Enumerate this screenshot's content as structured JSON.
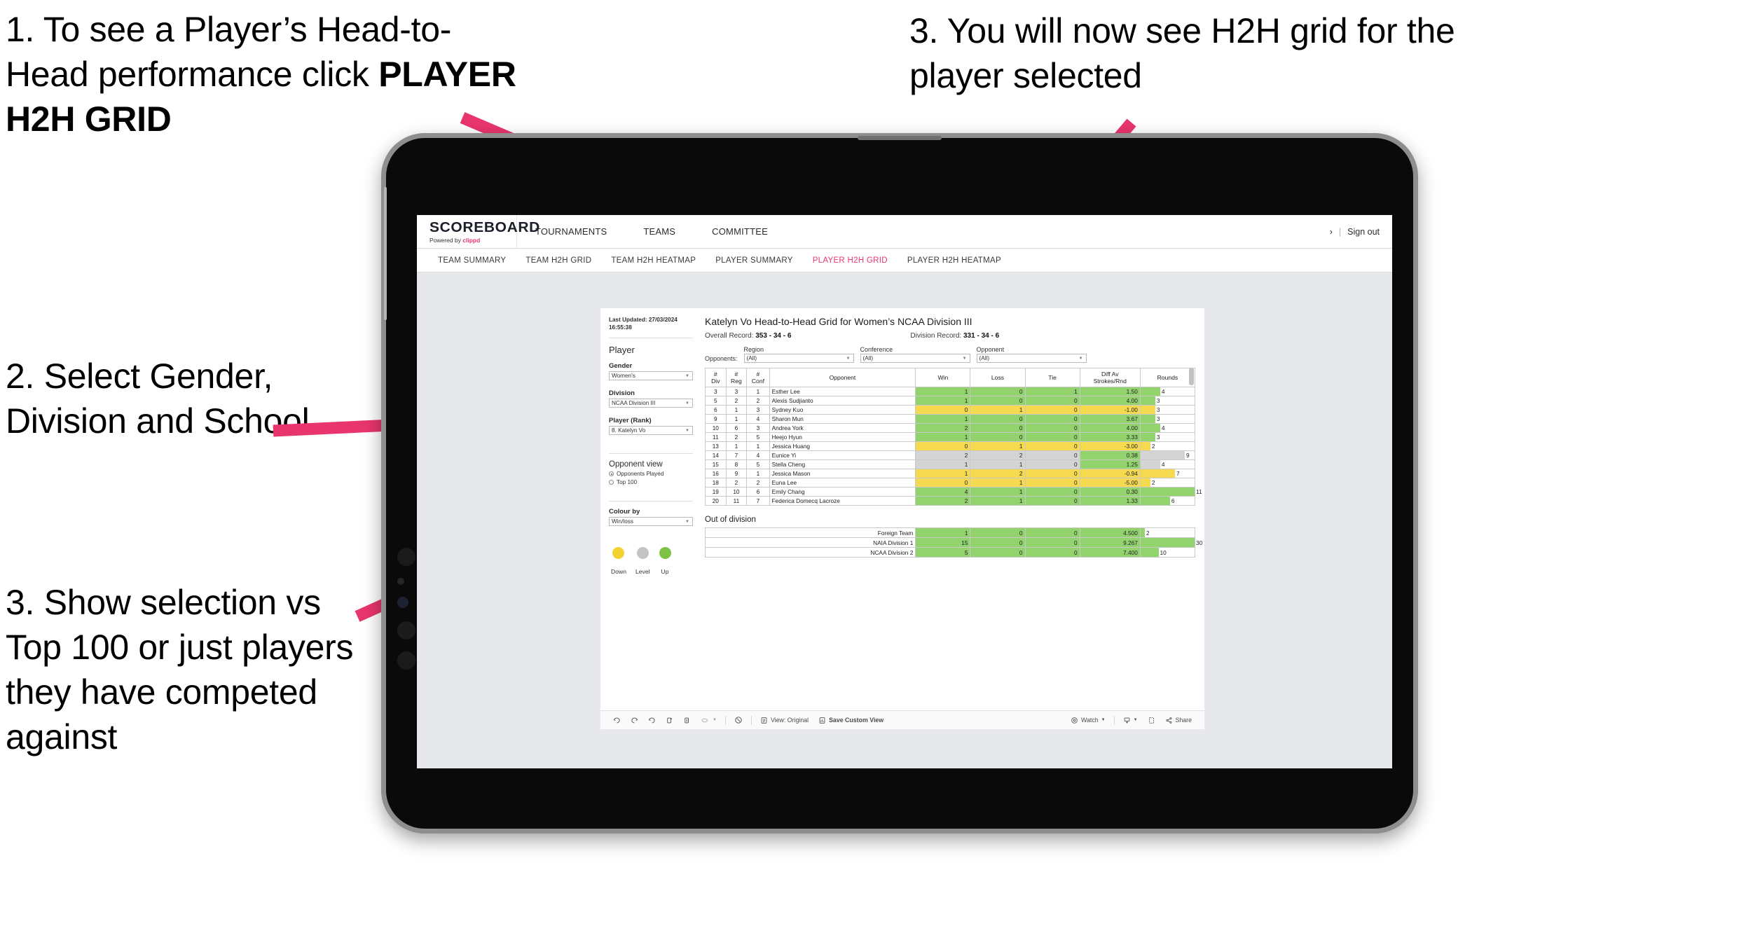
{
  "annotations": [
    {
      "id": 1,
      "pre": "1. To see a Player’s Head-to-Head performance click ",
      "strong": "PLAYER H2H GRID"
    },
    {
      "id": 2,
      "text": "2. Select Gender, Division and School"
    },
    {
      "id": 3,
      "text": "3. Show selection vs Top 100 or just players they have competed against"
    },
    {
      "id": 4,
      "text": "3. You will now see H2H grid for the player selected"
    }
  ],
  "app": {
    "brand_name": "SCOREBOARD",
    "brand_sub_prefix": "Powered by ",
    "brand_sub_accent": "clippd",
    "top_nav": [
      "TOURNAMENTS",
      "TEAMS",
      "COMMITTEE"
    ],
    "top_right": {
      "chevron": "›",
      "separator": "|",
      "sign_out": "Sign out"
    },
    "sub_nav": [
      {
        "label": "TEAM SUMMARY",
        "active": false
      },
      {
        "label": "TEAM H2H GRID",
        "active": false
      },
      {
        "label": "TEAM H2H HEATMAP",
        "active": false
      },
      {
        "label": "PLAYER SUMMARY",
        "active": false
      },
      {
        "label": "PLAYER H2H GRID",
        "active": true
      },
      {
        "label": "PLAYER H2H HEATMAP",
        "active": false
      }
    ],
    "accent_color": "#e8356d"
  },
  "sidebar": {
    "last_updated": "Last Updated: 27/03/2024 16:55:38",
    "player_heading": "Player",
    "filters": [
      {
        "label": "Gender",
        "value": "Women’s"
      },
      {
        "label": "Division",
        "value": "NCAA Division III"
      },
      {
        "label": "Player (Rank)",
        "value": "8. Katelyn Vo"
      }
    ],
    "opponent_view": {
      "heading": "Opponent view",
      "options": [
        {
          "label": "Opponents Played",
          "selected": true
        },
        {
          "label": "Top 100",
          "selected": false
        }
      ]
    },
    "colour_by": {
      "label": "Colour by",
      "value": "Win/loss"
    },
    "legend": [
      {
        "label": "Down",
        "color": "#f2d230"
      },
      {
        "label": "Level",
        "color": "#c3c3c3"
      },
      {
        "label": "Up",
        "color": "#7dc242"
      }
    ]
  },
  "main": {
    "title": "Katelyn Vo Head-to-Head Grid for Women’s NCAA Division III",
    "overall_record_label": "Overall Record: ",
    "overall_record": "353 - 34 - 6",
    "division_record_label": "Division Record: ",
    "division_record": "331 - 34 - 6",
    "opponents_label": "Opponents:",
    "opponent_filters": [
      {
        "label": "Region",
        "value": "(All)"
      },
      {
        "label": "Conference",
        "value": "(All)"
      },
      {
        "label": "Opponent",
        "value": "(All)"
      }
    ],
    "columns": [
      "# Div",
      "# Reg",
      "# Conf",
      "Opponent",
      "Win",
      "Loss",
      "Tie",
      "Diff Av Strokes/Rnd",
      "Rounds"
    ],
    "rows": [
      {
        "div": "3",
        "reg": "3",
        "conf": "1",
        "opponent": "Esther Lee",
        "win": "1",
        "loss": "0",
        "tie": "1",
        "diff": "1.50",
        "rounds": "4",
        "state": "up"
      },
      {
        "div": "5",
        "reg": "2",
        "conf": "2",
        "opponent": "Alexis Sudjianto",
        "win": "1",
        "loss": "0",
        "tie": "0",
        "diff": "4.00",
        "rounds": "3",
        "state": "up"
      },
      {
        "div": "6",
        "reg": "1",
        "conf": "3",
        "opponent": "Sydney Kuo",
        "win": "0",
        "loss": "1",
        "tie": "0",
        "diff": "-1.00",
        "rounds": "3",
        "state": "down"
      },
      {
        "div": "9",
        "reg": "1",
        "conf": "4",
        "opponent": "Sharon Mun",
        "win": "1",
        "loss": "0",
        "tie": "0",
        "diff": "3.67",
        "rounds": "3",
        "state": "up"
      },
      {
        "div": "10",
        "reg": "6",
        "conf": "3",
        "opponent": "Andrea York",
        "win": "2",
        "loss": "0",
        "tie": "0",
        "diff": "4.00",
        "rounds": "4",
        "state": "up"
      },
      {
        "div": "11",
        "reg": "2",
        "conf": "5",
        "opponent": "Heejo Hyun",
        "win": "1",
        "loss": "0",
        "tie": "0",
        "diff": "3.33",
        "rounds": "3",
        "state": "up"
      },
      {
        "div": "13",
        "reg": "1",
        "conf": "1",
        "opponent": "Jessica Huang",
        "win": "0",
        "loss": "1",
        "tie": "0",
        "diff": "-3.00",
        "rounds": "2",
        "state": "down"
      },
      {
        "div": "14",
        "reg": "7",
        "conf": "4",
        "opponent": "Eunice Yi",
        "win": "2",
        "loss": "2",
        "tie": "0",
        "diff": "0.38",
        "rounds": "9",
        "state": "level",
        "diff_state": "up"
      },
      {
        "div": "15",
        "reg": "8",
        "conf": "5",
        "opponent": "Stella Cheng",
        "win": "1",
        "loss": "1",
        "tie": "0",
        "diff": "1.25",
        "rounds": "4",
        "state": "level",
        "diff_state": "up"
      },
      {
        "div": "16",
        "reg": "9",
        "conf": "1",
        "opponent": "Jessica Mason",
        "win": "1",
        "loss": "2",
        "tie": "0",
        "diff": "-0.94",
        "rounds": "7",
        "state": "down"
      },
      {
        "div": "18",
        "reg": "2",
        "conf": "2",
        "opponent": "Euna Lee",
        "win": "0",
        "loss": "1",
        "tie": "0",
        "diff": "-5.00",
        "rounds": "2",
        "state": "down"
      },
      {
        "div": "19",
        "reg": "10",
        "conf": "6",
        "opponent": "Emily Chang",
        "win": "4",
        "loss": "1",
        "tie": "0",
        "diff": "0.30",
        "rounds": "11",
        "state": "up"
      },
      {
        "div": "20",
        "reg": "11",
        "conf": "7",
        "opponent": "Federica Domecq Lacroze",
        "win": "2",
        "loss": "1",
        "tie": "0",
        "diff": "1.33",
        "rounds": "6",
        "state": "up"
      }
    ],
    "out_of_division_heading": "Out of division",
    "out_of_division_rows": [
      {
        "label": "Foreign Team",
        "win": "1",
        "loss": "0",
        "tie": "0",
        "diff": "4.500",
        "rounds": "2",
        "state": "up"
      },
      {
        "label": "NAIA Division 1",
        "win": "15",
        "loss": "0",
        "tie": "0",
        "diff": "9.267",
        "rounds": "30",
        "state": "up"
      },
      {
        "label": "NCAA Division 2",
        "win": "5",
        "loss": "0",
        "tie": "0",
        "diff": "7.400",
        "rounds": "10",
        "state": "up"
      }
    ]
  },
  "toolbar": {
    "view_label": "View: Original",
    "save_label": "Save Custom View",
    "watch_label": "Watch",
    "share_label": "Share"
  }
}
